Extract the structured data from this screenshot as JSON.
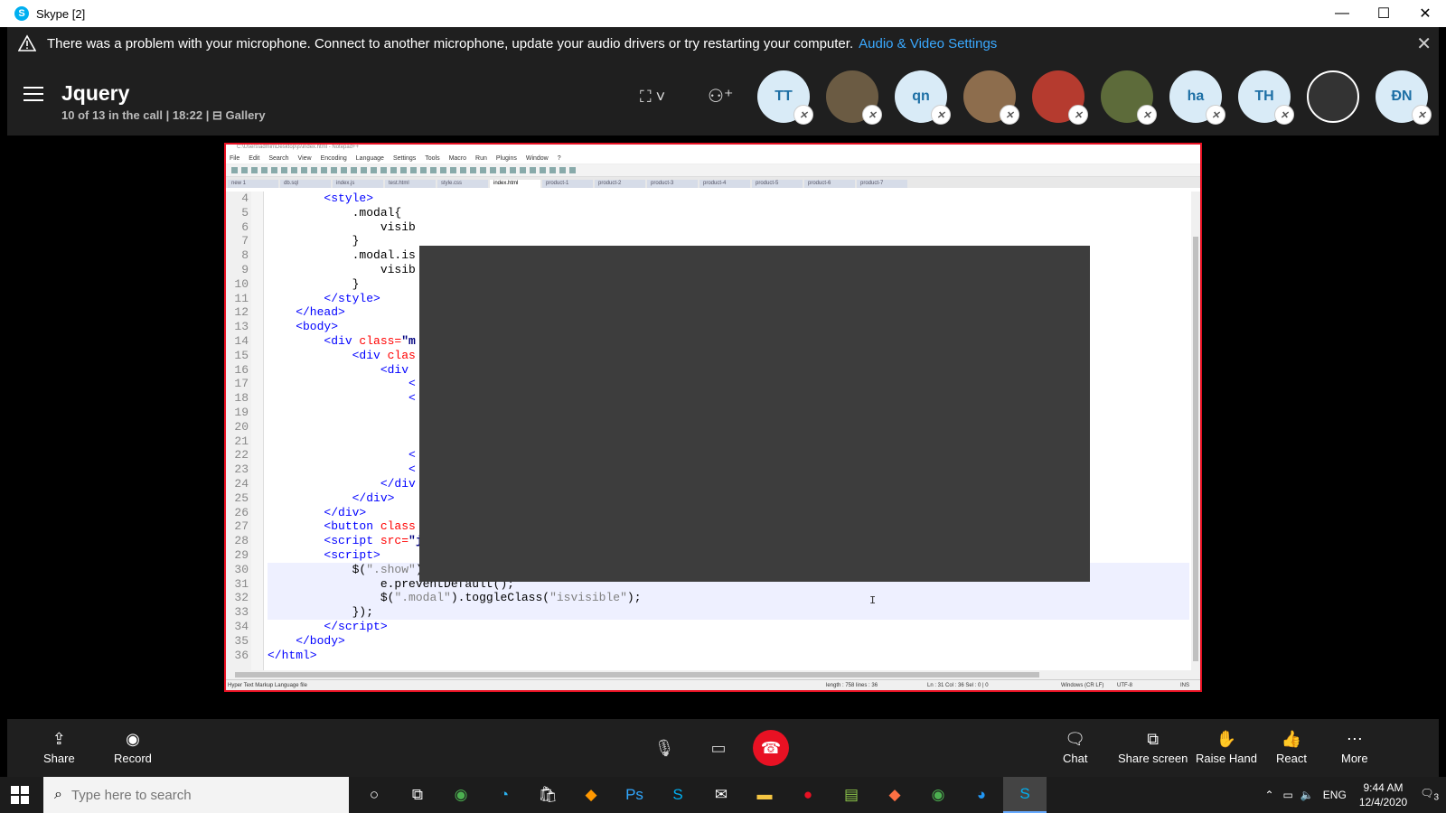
{
  "window": {
    "title": "Skype [2]",
    "minimize": "—",
    "maximize": "☐",
    "close": "✕"
  },
  "notice": {
    "message": "There was a problem with your microphone. Connect to another microphone, update your audio drivers or try restarting your computer.",
    "link": "Audio & Video Settings",
    "close": "✕"
  },
  "call": {
    "name": "Jquery",
    "info": "10 of 13 in the call | 18:22 |",
    "view_mode": "Gallery"
  },
  "participants": [
    {
      "initials": "TT",
      "photo": false
    },
    {
      "initials": "",
      "photo": true
    },
    {
      "initials": "qn",
      "photo": false
    },
    {
      "initials": "",
      "photo": true
    },
    {
      "initials": "",
      "photo": true
    },
    {
      "initials": "",
      "photo": true
    },
    {
      "initials": "ha",
      "photo": false
    },
    {
      "initials": "TH",
      "photo": false
    },
    {
      "initials": "",
      "photo": true
    },
    {
      "initials": "ĐN",
      "photo": false
    }
  ],
  "editor": {
    "line_numbers": [
      "4",
      "5",
      "6",
      "7",
      "8",
      "9",
      "10",
      "11",
      "12",
      "13",
      "14",
      "15",
      "16",
      "17",
      "18",
      "19",
      "20",
      "21",
      "22",
      "23",
      "24",
      "25",
      "26",
      "27",
      "28",
      "29",
      "30",
      "31",
      "32",
      "33",
      "34",
      "35",
      "36"
    ],
    "status_left": "Hyper Text Markup Language file",
    "status_length": "length : 758   lines : 36",
    "status_pos": "Ln : 31   Col : 36   Sel : 0 | 0",
    "status_eol": "Windows (CR LF)",
    "status_enc": "UTF-8",
    "status_ins": "INS"
  },
  "controls": {
    "share": "Share",
    "record": "Record",
    "chat": "Chat",
    "share_screen": "Share screen",
    "raise_hand": "Raise Hand",
    "react": "React",
    "more": "More"
  },
  "taskbar": {
    "search_placeholder": "Type here to search",
    "lang": "ENG",
    "time": "9:44 AM",
    "date": "12/4/2020",
    "notifications": "3"
  },
  "colors": {
    "accent": "#3aa9ff",
    "hangup": "#e81123",
    "share_border": "#e81123"
  }
}
